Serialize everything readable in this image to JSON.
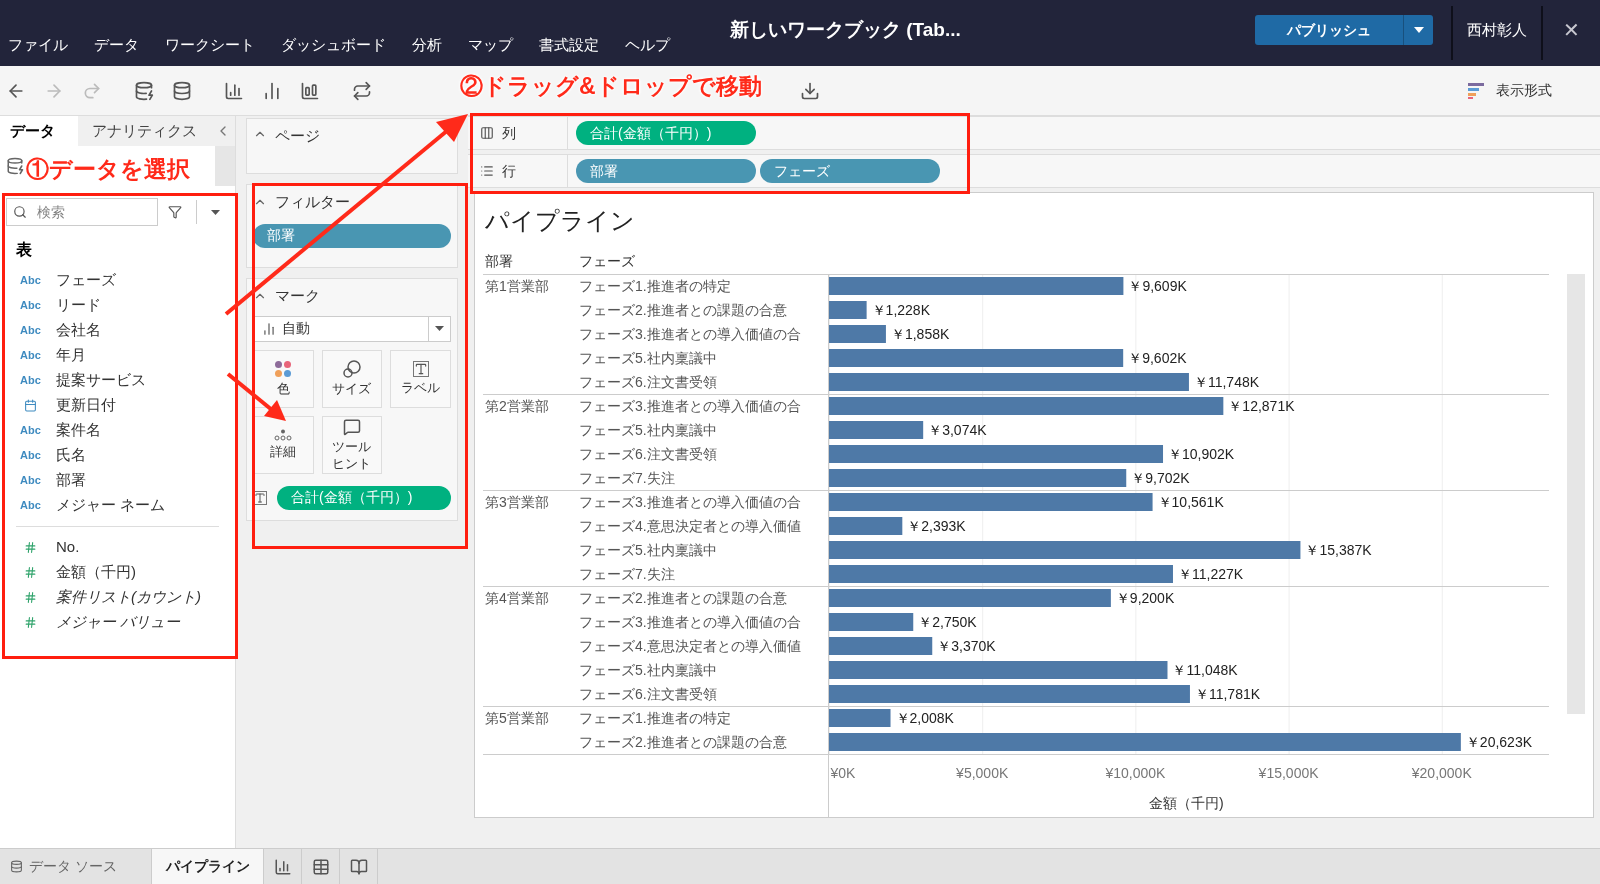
{
  "menu": [
    "ファイル",
    "データ",
    "ワークシート",
    "ダッシュボード",
    "分析",
    "マップ",
    "書式設定",
    "ヘルプ"
  ],
  "window": {
    "title": "新しいワークブック (Tab...",
    "publish": "パブリッシュ",
    "user": "西村彰人",
    "close": "✕"
  },
  "toolbar": {
    "show_me": "表示形式"
  },
  "side_tabs": [
    {
      "label": "データ",
      "selected": true
    },
    {
      "label": "アナリティクス",
      "selected": false
    }
  ],
  "data_pane": {
    "search": {
      "placeholder": "検索"
    },
    "table_heading": "表",
    "fields": [
      {
        "kind": "string",
        "type_label": "Abc",
        "name": "フェーズ",
        "italic": false
      },
      {
        "kind": "string",
        "type_label": "Abc",
        "name": "リード",
        "italic": false
      },
      {
        "kind": "string",
        "type_label": "Abc",
        "name": "会社名",
        "italic": false
      },
      {
        "kind": "string",
        "type_label": "Abc",
        "name": "年月",
        "italic": false
      },
      {
        "kind": "string",
        "type_label": "Abc",
        "name": "提案サービス",
        "italic": false
      },
      {
        "kind": "date",
        "name": "更新日付",
        "italic": false
      },
      {
        "kind": "string",
        "type_label": "Abc",
        "name": "案件名",
        "italic": false
      },
      {
        "kind": "string",
        "type_label": "Abc",
        "name": "氏名",
        "italic": false
      },
      {
        "kind": "string",
        "type_label": "Abc",
        "name": "部署",
        "italic": false
      },
      {
        "kind": "string",
        "type_label": "Abc",
        "name": "メジャー ネーム",
        "italic": false
      },
      {
        "kind": "measure",
        "name": "No.",
        "italic": false
      },
      {
        "kind": "measure",
        "name": "金額（千円)",
        "italic": false
      },
      {
        "kind": "measure",
        "name": "案件リスト(カウント)",
        "italic": true
      },
      {
        "kind": "measure",
        "name": "メジャー バリュー",
        "italic": true
      }
    ]
  },
  "pages_card": {
    "title": "ページ"
  },
  "filters_card": {
    "title": "フィルター",
    "pills": [
      {
        "label": "部署",
        "color": "#4996b2"
      }
    ]
  },
  "marks_card": {
    "title": "マーク",
    "mark_type": "自動",
    "buttons": [
      {
        "kind": "color",
        "label": "色"
      },
      {
        "kind": "size",
        "label": "サイズ"
      },
      {
        "kind": "label",
        "label": "ラベル"
      },
      {
        "kind": "detail",
        "label": "詳細"
      },
      {
        "kind": "tooltip",
        "label": "ツールヒント"
      }
    ],
    "pills": [
      {
        "label": "合計(金額（千円）)",
        "color": "#00b180"
      }
    ]
  },
  "shelves": [
    {
      "kind": "columns",
      "label": "列",
      "pills": [
        {
          "label": "合計(金額（千円）)",
          "color": "#00b180"
        }
      ]
    },
    {
      "kind": "rows",
      "label": "行",
      "pills": [
        {
          "label": "部署",
          "color": "#4996b2"
        },
        {
          "label": "フェーズ",
          "color": "#4996b2"
        }
      ]
    }
  ],
  "view": {
    "title": "パイプライン",
    "headers": [
      "部署",
      "フェーズ"
    ],
    "groups": [
      {
        "name": "第1営業部",
        "phases": [
          "フェーズ1.推進者の特定",
          "フェーズ2.推進者との課題の合意",
          "フェーズ3.推進者との導入価値の合",
          "フェーズ5.社内稟議中",
          "フェーズ6.注文書受領"
        ]
      },
      {
        "name": "第2営業部",
        "phases": [
          "フェーズ3.推進者との導入価値の合",
          "フェーズ5.社内稟議中",
          "フェーズ6.注文書受領",
          "フェーズ7.失注"
        ]
      },
      {
        "name": "第3営業部",
        "phases": [
          "フェーズ3.推進者との導入価値の合",
          "フェーズ4.意思決定者との導入価値",
          "フェーズ5.社内稟議中",
          "フェーズ7.失注"
        ]
      },
      {
        "name": "第4営業部",
        "phases": [
          "フェーズ2.推進者との課題の合意",
          "フェーズ3.推進者との導入価値の合",
          "フェーズ4.意思決定者との導入価値",
          "フェーズ5.社内稟議中",
          "フェーズ6.注文書受領"
        ]
      },
      {
        "name": "第5営業部",
        "phases": [
          "フェーズ1.推進者の特定",
          "フェーズ2.推進者との課題の合意"
        ]
      }
    ],
    "chart_data": {
      "type": "bar",
      "orientation": "horizontal",
      "xlabel": "金額（千円)",
      "xlim": [
        0,
        23500
      ],
      "grid": true,
      "xticks": [
        {
          "value": 0,
          "label": "¥0K"
        },
        {
          "value": 5000,
          "label": "¥5,000K"
        },
        {
          "value": 10000,
          "label": "¥10,000K"
        },
        {
          "value": 15000,
          "label": "¥15,000K"
        },
        {
          "value": 20000,
          "label": "¥20,000K"
        }
      ],
      "values": [
        9609,
        1228,
        1858,
        9602,
        11748,
        12871,
        3074,
        10902,
        9702,
        10561,
        2393,
        15387,
        11227,
        9200,
        2750,
        3370,
        11048,
        11781,
        2008,
        20623
      ],
      "value_labels": [
        "￥9,609K",
        "￥1,228K",
        "￥1,858K",
        "￥9,602K",
        "￥11,748K",
        "￥12,871K",
        "￥3,074K",
        "￥10,902K",
        "￥9,702K",
        "￥10,561K",
        "￥2,393K",
        "￥15,387K",
        "￥11,227K",
        "￥9,200K",
        "￥2,750K",
        "￥3,370K",
        "￥11,048K",
        "￥11,781K",
        "￥2,008K",
        "￥20,623K"
      ]
    }
  },
  "sheet_tabs": [
    {
      "kind": "datasource",
      "label": "データ ソース",
      "selected": false
    },
    {
      "kind": "sheet",
      "label": "パイプライン",
      "selected": true
    }
  ],
  "annotations": [
    {
      "label": "①データを選択"
    },
    {
      "label": "②ドラッグ&ドロップで移動"
    }
  ]
}
